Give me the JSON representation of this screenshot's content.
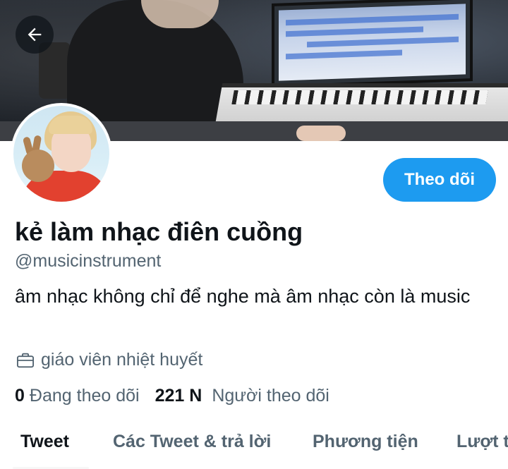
{
  "header": {
    "back_icon": "arrow-left-icon"
  },
  "profile": {
    "display_name": "kẻ làm nhạc điên cuồng",
    "handle": "@musicinstrument",
    "bio": "âm nhạc không chỉ để nghe mà âm nhạc còn là music",
    "job": "giáo viên nhiệt huyết",
    "job_icon": "briefcase-icon",
    "follow_label": "Theo dõi",
    "following_count": "0",
    "following_label": "Đang theo dõi",
    "followers_count": "221 N",
    "followers_label": "Người theo dõi"
  },
  "tabs": [
    {
      "label": "Tweet",
      "active": true
    },
    {
      "label": "Các Tweet & trả lời",
      "active": false
    },
    {
      "label": "Phương tiện",
      "active": false
    },
    {
      "label": "Lượt t",
      "active": false
    }
  ],
  "colors": {
    "accent": "#1d9bf0",
    "text_primary": "#0f1419",
    "text_secondary": "#536471"
  }
}
